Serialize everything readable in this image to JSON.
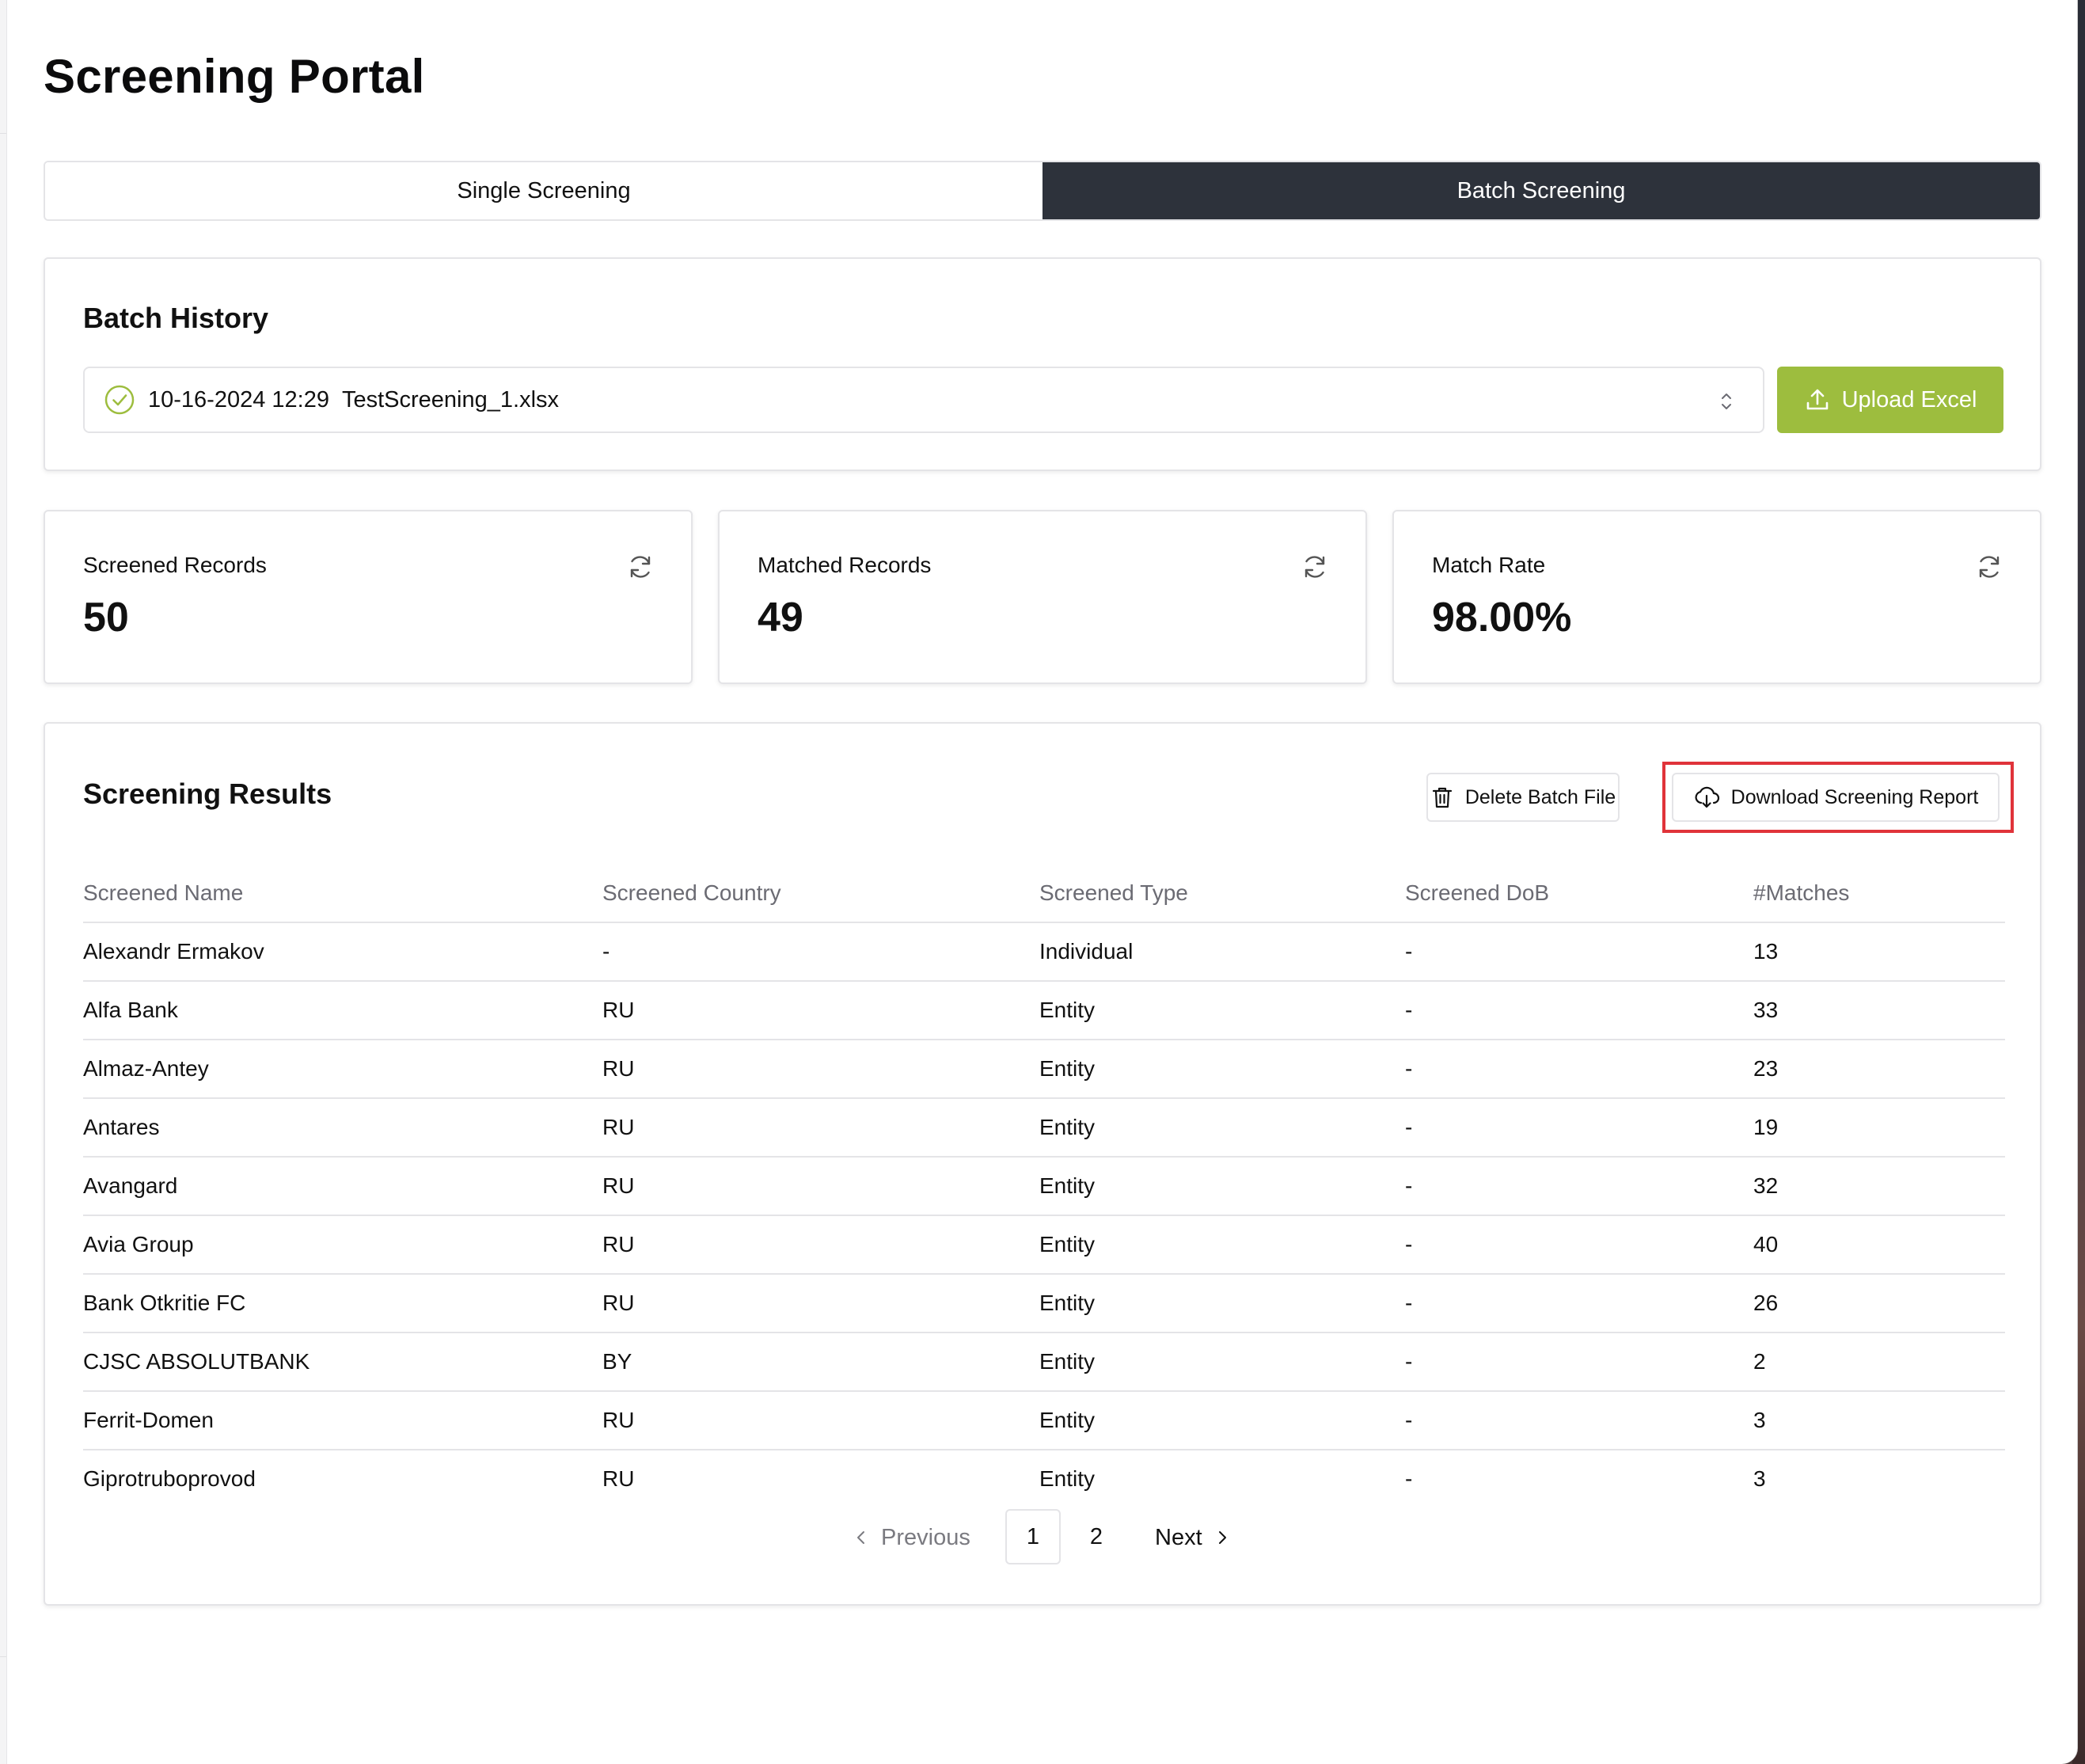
{
  "page": {
    "title": "Screening Portal"
  },
  "tabs": [
    {
      "label": "Single Screening",
      "active": false
    },
    {
      "label": "Batch Screening",
      "active": true
    }
  ],
  "batch_history": {
    "title": "Batch History",
    "selected": {
      "status_icon": "check-circle-icon",
      "date": "10-16-2024 12:29",
      "file": "TestScreening_1.xlsx"
    },
    "upload_button": "Upload Excel"
  },
  "stats": [
    {
      "label": "Screened Records",
      "value": "50"
    },
    {
      "label": "Matched Records",
      "value": "49"
    },
    {
      "label": "Match Rate",
      "value": "98.00%"
    }
  ],
  "results": {
    "title": "Screening Results",
    "delete_button": "Delete Batch File",
    "download_button": "Download Screening Report",
    "columns": [
      "Screened Name",
      "Screened Country",
      "Screened Type",
      "Screened DoB",
      "#Matches"
    ],
    "rows": [
      [
        "Alexandr Ermakov",
        "-",
        "Individual",
        "-",
        "13"
      ],
      [
        "Alfa Bank",
        "RU",
        "Entity",
        "-",
        "33"
      ],
      [
        "Almaz-Antey",
        "RU",
        "Entity",
        "-",
        "23"
      ],
      [
        "Antares",
        "RU",
        "Entity",
        "-",
        "19"
      ],
      [
        "Avangard",
        "RU",
        "Entity",
        "-",
        "32"
      ],
      [
        "Avia Group",
        "RU",
        "Entity",
        "-",
        "40"
      ],
      [
        "Bank Otkritie FC",
        "RU",
        "Entity",
        "-",
        "26"
      ],
      [
        "CJSC ABSOLUTBANK",
        "BY",
        "Entity",
        "-",
        "2"
      ],
      [
        "Ferrit-Domen",
        "RU",
        "Entity",
        "-",
        "3"
      ],
      [
        "Giprotruboprovod",
        "RU",
        "Entity",
        "-",
        "3"
      ]
    ]
  },
  "pagination": {
    "previous": "Previous",
    "next": "Next",
    "pages": [
      "1",
      "2"
    ],
    "current": "1"
  },
  "colors": {
    "accent_green": "#9dbd3e",
    "tab_active_bg": "#2d323b",
    "highlight_red": "#e0333a"
  }
}
